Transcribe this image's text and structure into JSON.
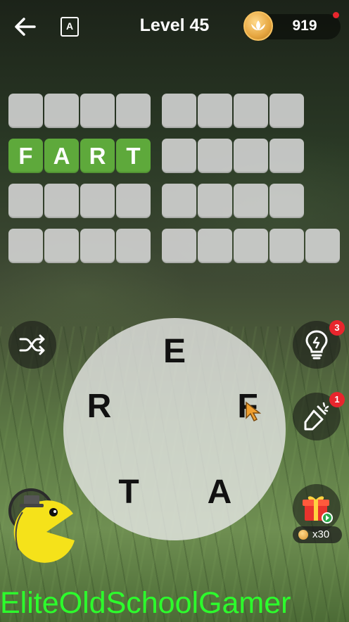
{
  "header": {
    "back_icon": "back-arrow-icon",
    "dictionary_icon": "dictionary-icon",
    "dictionary_glyph": "A",
    "level_label": "Level 45",
    "coins": "919"
  },
  "board": {
    "rows": [
      [
        "",
        "",
        "",
        ""
      ],
      [
        "F",
        "A",
        "R",
        "T"
      ],
      [
        "",
        "",
        "",
        ""
      ],
      [
        "",
        "",
        "",
        ""
      ]
    ],
    "right_rows": [
      [
        "",
        "",
        "",
        ""
      ],
      [
        "",
        "",
        "",
        ""
      ],
      [
        "",
        "",
        "",
        ""
      ],
      [
        "",
        "",
        "",
        "",
        ""
      ]
    ]
  },
  "wheel": {
    "letters": [
      "E",
      "F",
      "A",
      "T",
      "R"
    ]
  },
  "buttons": {
    "shuffle_icon": "shuffle-icon",
    "hint_icon": "lightbulb-icon",
    "hint_badge": "3",
    "firework_icon": "firework-icon",
    "firework_badge": "1",
    "gift_icon": "gift-icon",
    "gift_reward": "x30"
  },
  "watermark": "EliteOldSchoolGamer",
  "colors": {
    "solved_tile": "#5ea93b",
    "empty_tile": "#d7d7d7",
    "watermark": "#2cff2c",
    "badge": "#e8262d"
  }
}
